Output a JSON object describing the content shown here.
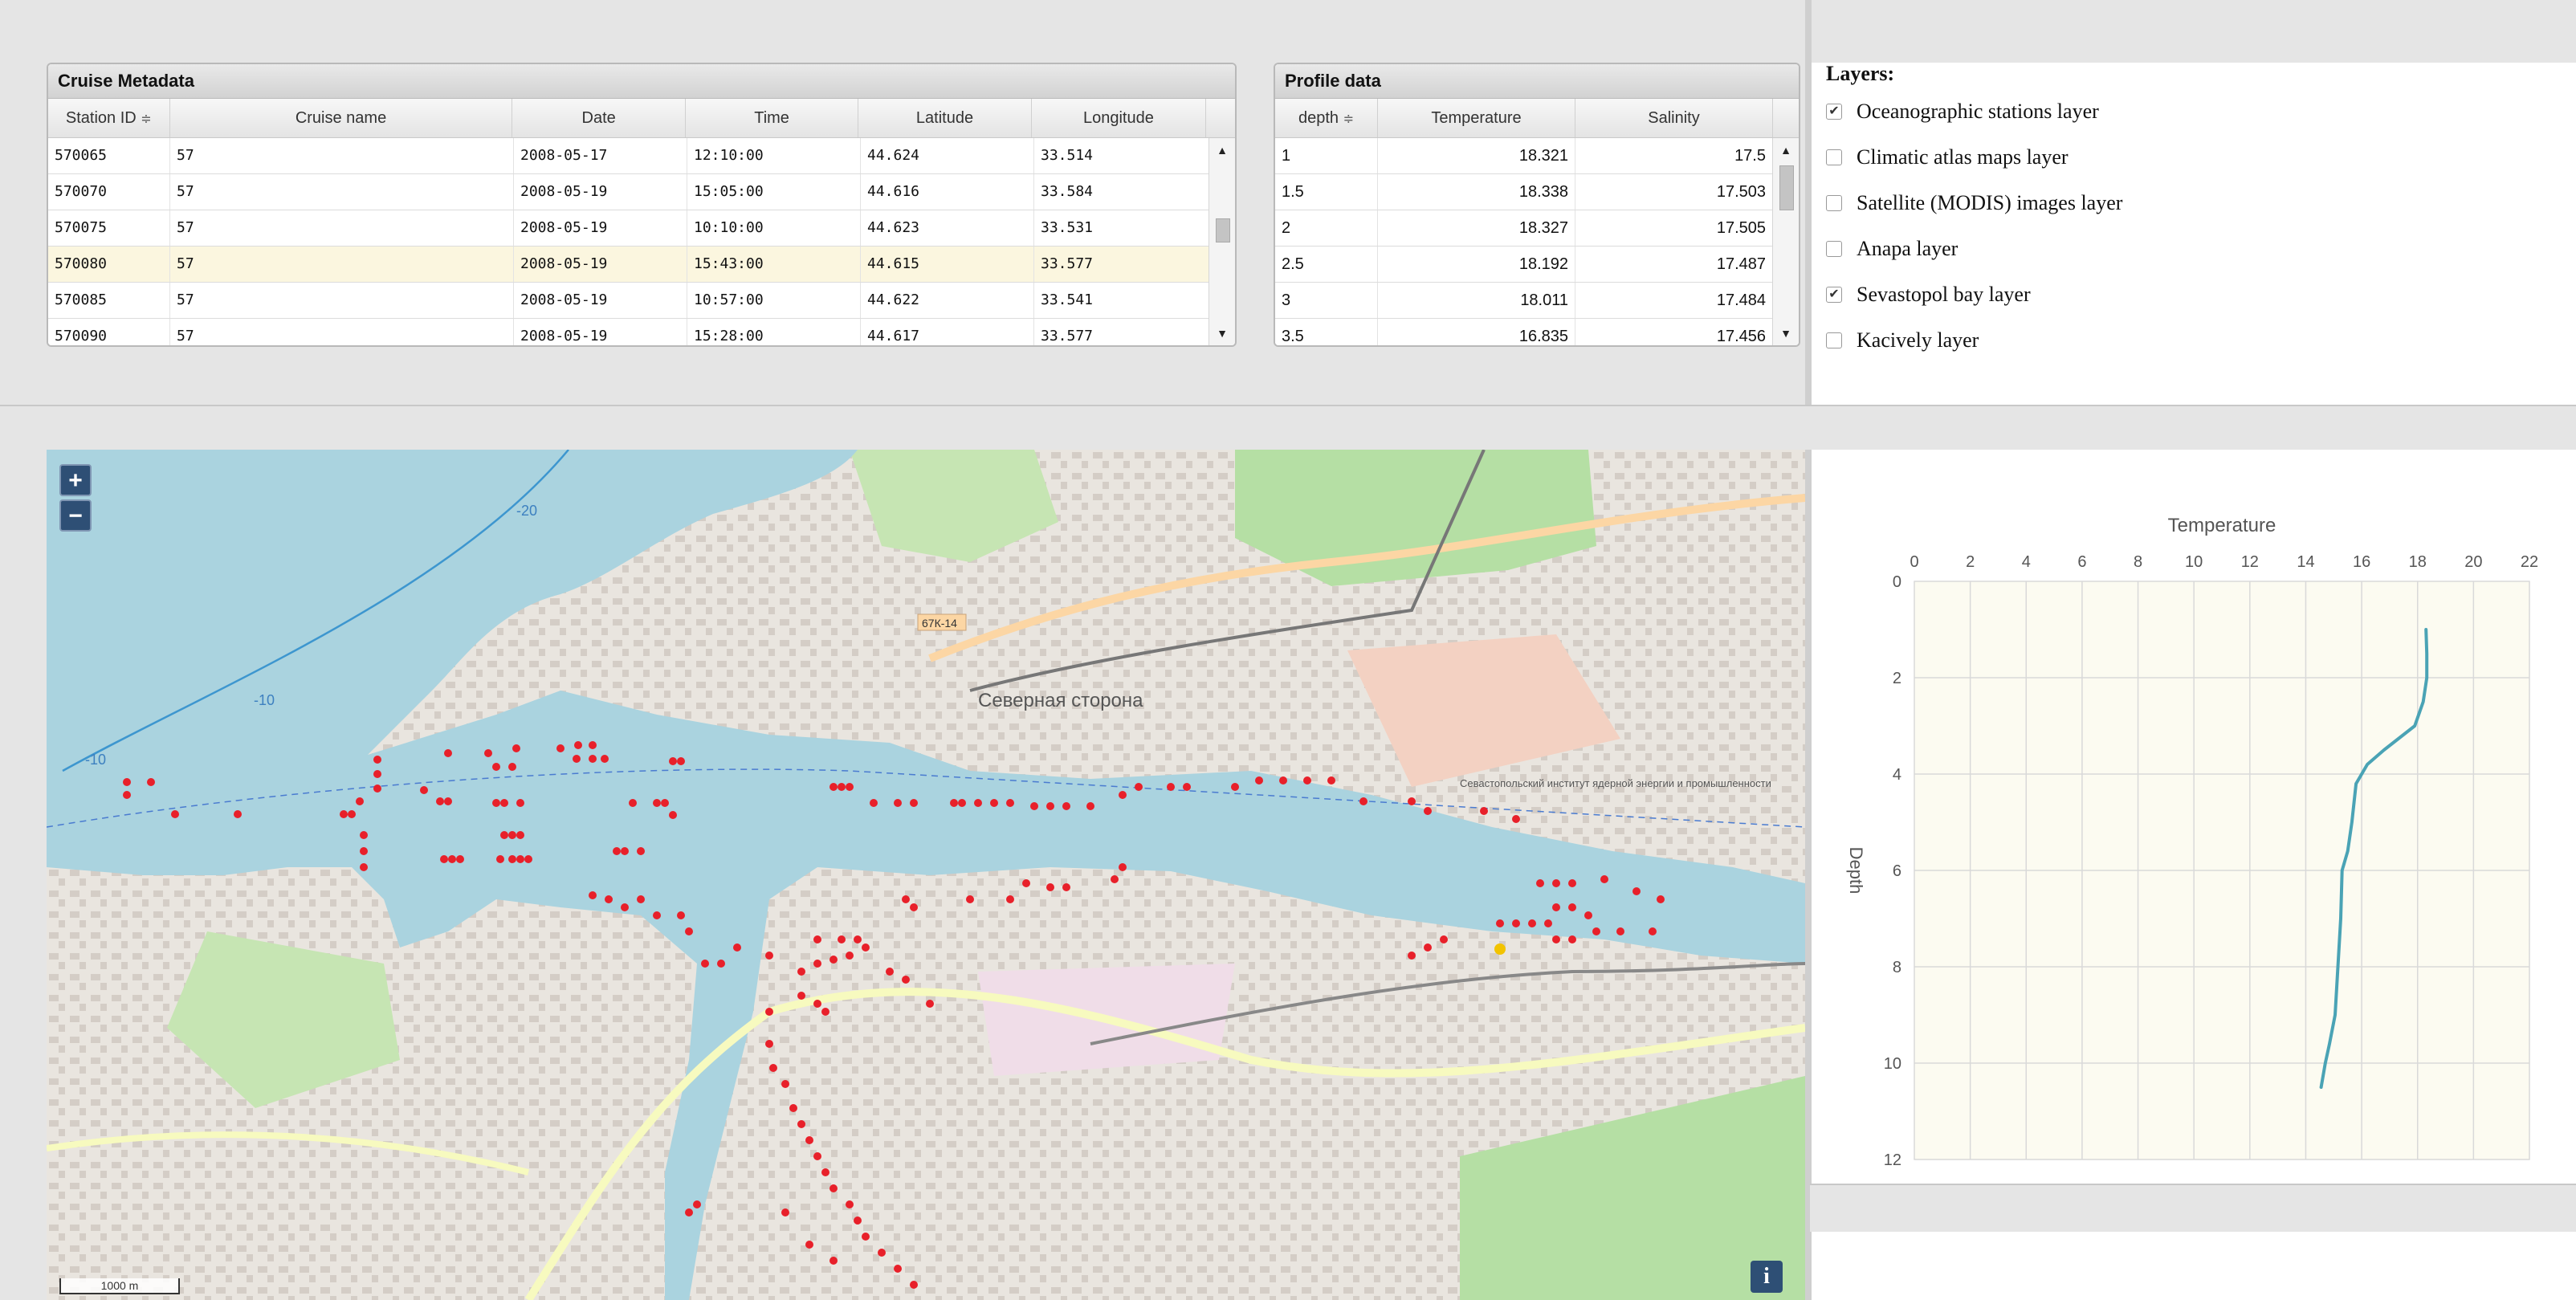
{
  "cruise_metadata": {
    "title": "Cruise Metadata",
    "columns": [
      "Station ID",
      "Cruise name",
      "Date",
      "Time",
      "Latitude",
      "Longitude"
    ],
    "sort_indicator": "≑",
    "rows": [
      [
        "570065",
        "57",
        "2008-05-17",
        "12:10:00",
        "44.624",
        "33.514"
      ],
      [
        "570070",
        "57",
        "2008-05-19",
        "15:05:00",
        "44.616",
        "33.584"
      ],
      [
        "570075",
        "57",
        "2008-05-19",
        "10:10:00",
        "44.623",
        "33.531"
      ],
      [
        "570080",
        "57",
        "2008-05-19",
        "15:43:00",
        "44.615",
        "33.577"
      ],
      [
        "570085",
        "57",
        "2008-05-19",
        "10:57:00",
        "44.622",
        "33.541"
      ],
      [
        "570090",
        "57",
        "2008-05-19",
        "15:28:00",
        "44.617",
        "33.577"
      ]
    ],
    "selected_row": 3
  },
  "profile_data": {
    "title": "Profile data",
    "columns": [
      "depth",
      "Temperature",
      "Salinity"
    ],
    "rows": [
      [
        "1",
        "18.321",
        "17.5"
      ],
      [
        "1.5",
        "18.338",
        "17.503"
      ],
      [
        "2",
        "18.327",
        "17.505"
      ],
      [
        "2.5",
        "18.192",
        "17.487"
      ],
      [
        "3",
        "18.011",
        "17.484"
      ],
      [
        "3.5",
        "16.835",
        "17.456"
      ]
    ]
  },
  "layers": {
    "title": "Layers:",
    "items": [
      {
        "label": "Oceanographic stations layer",
        "checked": true
      },
      {
        "label": "Climatic atlas maps layer",
        "checked": false
      },
      {
        "label": "Satellite (MODIS) images layer",
        "checked": false
      },
      {
        "label": "Anapa layer",
        "checked": false
      },
      {
        "label": "Sevastopol bay layer",
        "checked": true
      },
      {
        "label": "Kacively layer",
        "checked": false
      }
    ]
  },
  "map": {
    "zoom_in": "+",
    "zoom_out": "−",
    "info": "i",
    "scale": "1000 m",
    "contours": [
      "-20",
      "-10",
      "-10"
    ],
    "place_labels": [
      "Северная сторона",
      "Севастопольский институт ядерной энергии и промышленности",
      "67К-14"
    ],
    "water_color": "#aad3df",
    "station_color": "#e8202a",
    "selected_station_color": "#f2c300"
  },
  "chart_data": {
    "type": "line",
    "title": "Temperature",
    "xlabel": "",
    "ylabel": "Depth",
    "xlim": [
      0,
      22
    ],
    "ylim": [
      12,
      0
    ],
    "x_axis_position": "top",
    "y_inverted": true,
    "xticks": [
      0,
      2,
      4,
      6,
      8,
      10,
      12,
      14,
      16,
      18,
      20,
      22
    ],
    "yticks": [
      0,
      2,
      4,
      6,
      8,
      10,
      12
    ],
    "grid": true,
    "series": [
      {
        "color": "#4aa3b5",
        "points": [
          [
            18.3,
            1.0
          ],
          [
            18.33,
            1.5
          ],
          [
            18.33,
            2.0
          ],
          [
            18.2,
            2.5
          ],
          [
            17.9,
            3.0
          ],
          [
            16.8,
            3.5
          ],
          [
            16.2,
            3.8
          ],
          [
            15.8,
            4.2
          ],
          [
            15.65,
            5.0
          ],
          [
            15.5,
            5.6
          ],
          [
            15.3,
            6.0
          ],
          [
            15.25,
            7.0
          ],
          [
            15.15,
            8.0
          ],
          [
            15.05,
            9.0
          ],
          [
            14.85,
            9.6
          ],
          [
            14.7,
            10.0
          ],
          [
            14.55,
            10.5
          ]
        ]
      }
    ]
  }
}
